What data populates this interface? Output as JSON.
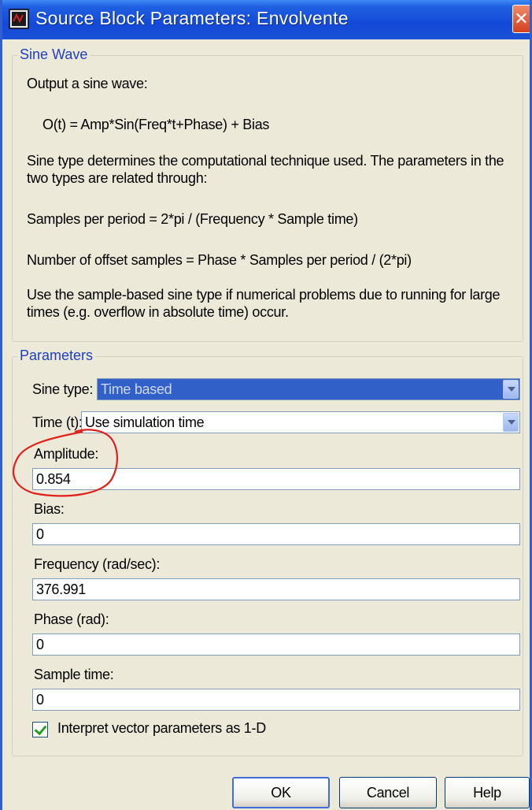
{
  "window": {
    "title": "Source Block Parameters: Envolvente",
    "app_icon": "simulink-block-icon",
    "close_icon": "close-icon",
    "close_glyph": "✕"
  },
  "sine_wave": {
    "legend": "Sine Wave",
    "line1": "Output a sine wave:",
    "formula": "O(t) = Amp*Sin(Freq*t+Phase) + Bias",
    "line2": "Sine type determines the computational technique used. The parameters in the two types are related through:",
    "line3": "Samples per period = 2*pi / (Frequency * Sample time)",
    "line4": "Number of offset samples = Phase * Samples per period / (2*pi)",
    "line5": "Use the sample-based sine type if numerical problems due to running for large times (e.g. overflow in absolute time) occur."
  },
  "parameters": {
    "legend": "Parameters",
    "sine_type": {
      "label": "Sine type:",
      "value": "Time based"
    },
    "time": {
      "label": "Time (t):",
      "value": "Use simulation time"
    },
    "amplitude": {
      "label": "Amplitude:",
      "value": "0.854"
    },
    "bias": {
      "label": "Bias:",
      "value": "0"
    },
    "frequency": {
      "label": "Frequency (rad/sec):",
      "value": "376.991"
    },
    "phase": {
      "label": "Phase (rad):",
      "value": "0"
    },
    "sample_time": {
      "label": "Sample time:",
      "value": "0"
    },
    "interpret_vector": {
      "label": "Interpret vector parameters as 1-D",
      "checked": true
    }
  },
  "buttons": {
    "ok": "OK",
    "cancel": "Cancel",
    "help": "Help"
  },
  "colors": {
    "titlebar": "#1449d8",
    "annotation": "#e0201a",
    "selection": "#3160c8"
  }
}
